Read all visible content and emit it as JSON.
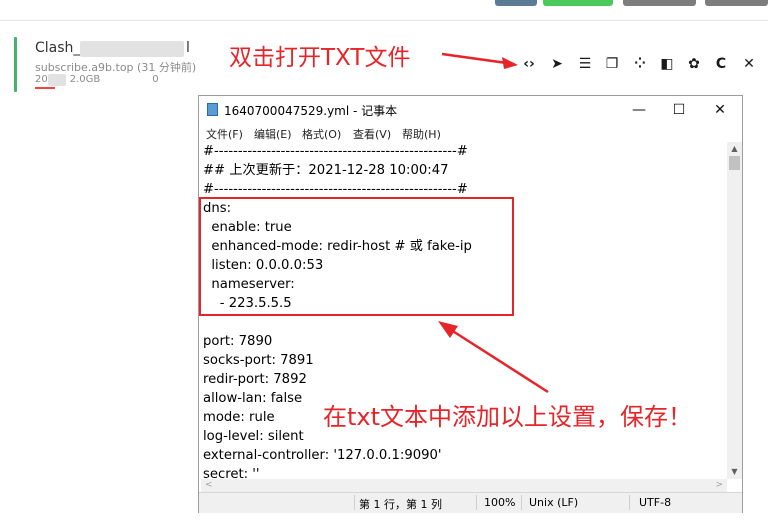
{
  "colors": {
    "accent_green": "#46b36a",
    "annotation_red": "#e5252a",
    "top_button_blue": "#5b7a95",
    "top_button_green": "#4cc95a",
    "top_button_gray": "#7d7d7d"
  },
  "profile": {
    "name": "Clash_",
    "name_suffix": "l",
    "subtitle": "subscribe.a9b.top (31 分钟前)",
    "usage_prefix": "20",
    "usage_mid": "2.0GB",
    "usage_suffix": "0"
  },
  "annotations": {
    "top": "双击打开TXT文件",
    "bottom": "在txt文本中添加以上设置，保存！"
  },
  "toolbar_icons": [
    "code-icon",
    "send-icon",
    "list-icon",
    "copy-icon",
    "qrcode-icon",
    "split-icon",
    "gear-icon",
    "refresh-icon",
    "close-icon"
  ],
  "toolbar_glyphs": {
    "code": "‹›",
    "send": "➤",
    "list": "☰",
    "copy": "❐",
    "qrcode": "⁘",
    "split": "◧",
    "gear": "✿",
    "refresh": "C",
    "close": "✕"
  },
  "notepad": {
    "title": "1640700047529.yml - 记事本",
    "buttons": {
      "min": "—",
      "max": "☐",
      "close": "✕"
    },
    "menu": [
      "文件(F)",
      "编辑(E)",
      "格式(O)",
      "查看(V)",
      "帮助(H)"
    ],
    "lines": [
      "#---------------------------------------------------#",
      "## 上次更新于：2021-12-28 10:00:47",
      "#---------------------------------------------------#",
      "dns:",
      "  enable: true",
      "  enhanced-mode: redir-host # 或 fake-ip",
      "  listen: 0.0.0.0:53",
      "  nameserver:",
      "    - 223.5.5.5",
      "",
      "port: 7890",
      "socks-port: 7891",
      "redir-port: 7892",
      "allow-lan: false",
      "mode: rule",
      "log-level: silent",
      "external-controller: '127.0.0.1:9090'",
      "secret: ''"
    ],
    "status": {
      "position": "第 1 行，第 1 列",
      "zoom": "100%",
      "eol": "Unix (LF)",
      "encoding": "UTF-8"
    },
    "scroll_glyphs": {
      "up": "▲",
      "down": "▼",
      "left": "<",
      "right": ">"
    }
  }
}
